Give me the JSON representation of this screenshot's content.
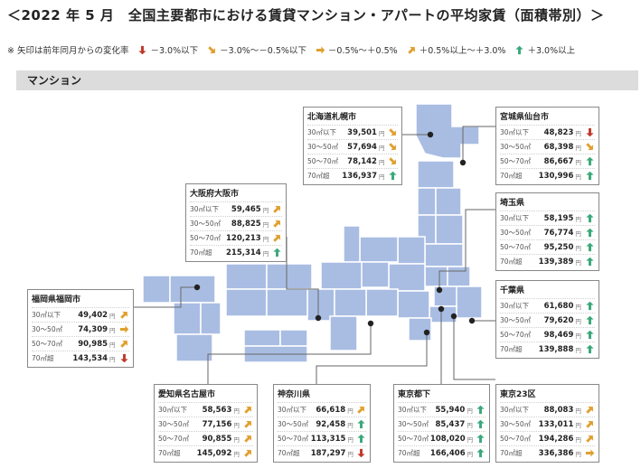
{
  "title": "＜2022 年 5 月　全国主要都市における賃貸マンション・アパートの平均家賃（面積帯別）＞",
  "legend": {
    "note": "※ 矢印は前年同月からの変化率",
    "items": [
      {
        "icon": "arrow-down-icon",
        "label": "－3.0%以下",
        "color": "#c0392b"
      },
      {
        "icon": "arrow-down-right-icon",
        "label": "－3.0%～－0.5%以下",
        "color": "#e0a030"
      },
      {
        "icon": "arrow-right-icon",
        "label": "－0.5%～＋0.5%",
        "color": "#e0a030"
      },
      {
        "icon": "arrow-up-right-icon",
        "label": "＋0.5%以上～＋3.0%",
        "color": "#e0a030"
      },
      {
        "icon": "arrow-up-icon",
        "label": "＋3.0%以上",
        "color": "#3aa87a"
      }
    ]
  },
  "section": "マンション",
  "unit": "円",
  "sizes": [
    "30㎡以下",
    "30～50㎡",
    "50～70㎡",
    "70㎡超"
  ],
  "colors": {
    "map": "#a9bde3",
    "map_stroke": "#ffffff",
    "line": "#666666"
  },
  "cities": [
    {
      "id": "sapporo",
      "name": "北海道札幌市",
      "values": [
        "39,501",
        "57,694",
        "78,142",
        "136,937"
      ],
      "trends": [
        "down-right",
        "down-right",
        "down-right",
        "up"
      ]
    },
    {
      "id": "sendai",
      "name": "宮城県仙台市",
      "values": [
        "48,823",
        "68,398",
        "86,667",
        "130,996"
      ],
      "trends": [
        "down",
        "down-right",
        "up",
        "up"
      ]
    },
    {
      "id": "osaka",
      "name": "大阪府大阪市",
      "values": [
        "59,465",
        "88,825",
        "120,213",
        "215,314"
      ],
      "trends": [
        "up-right",
        "up-right",
        "up-right",
        "up"
      ]
    },
    {
      "id": "saitama",
      "name": "埼玉県",
      "values": [
        "58,195",
        "76,774",
        "95,250",
        "139,389"
      ],
      "trends": [
        "up",
        "up",
        "up",
        "up"
      ]
    },
    {
      "id": "fukuoka",
      "name": "福岡県福岡市",
      "values": [
        "49,402",
        "74,309",
        "90,985",
        "143,534"
      ],
      "trends": [
        "up-right",
        "right",
        "up-right",
        "down"
      ]
    },
    {
      "id": "chiba",
      "name": "千葉県",
      "values": [
        "61,680",
        "79,620",
        "98,469",
        "139,888"
      ],
      "trends": [
        "up",
        "up",
        "up",
        "up"
      ]
    },
    {
      "id": "nagoya",
      "name": "愛知県名古屋市",
      "values": [
        "58,563",
        "77,156",
        "90,855",
        "145,092"
      ],
      "trends": [
        "up-right",
        "up-right",
        "up-right",
        "up-right"
      ]
    },
    {
      "id": "kanagawa",
      "name": "神奈川県",
      "values": [
        "66,618",
        "92,458",
        "113,315",
        "187,297"
      ],
      "trends": [
        "up-right",
        "up",
        "up",
        "down"
      ]
    },
    {
      "id": "tokyo",
      "name": "東京都下",
      "values": [
        "55,940",
        "85,437",
        "108,020",
        "166,406"
      ],
      "trends": [
        "up",
        "up",
        "up",
        "up"
      ]
    },
    {
      "id": "tokyo23",
      "name": "東京23区",
      "values": [
        "88,083",
        "133,011",
        "194,286",
        "336,386"
      ],
      "trends": [
        "up-right",
        "up-right",
        "up-right",
        "right"
      ]
    }
  ]
}
